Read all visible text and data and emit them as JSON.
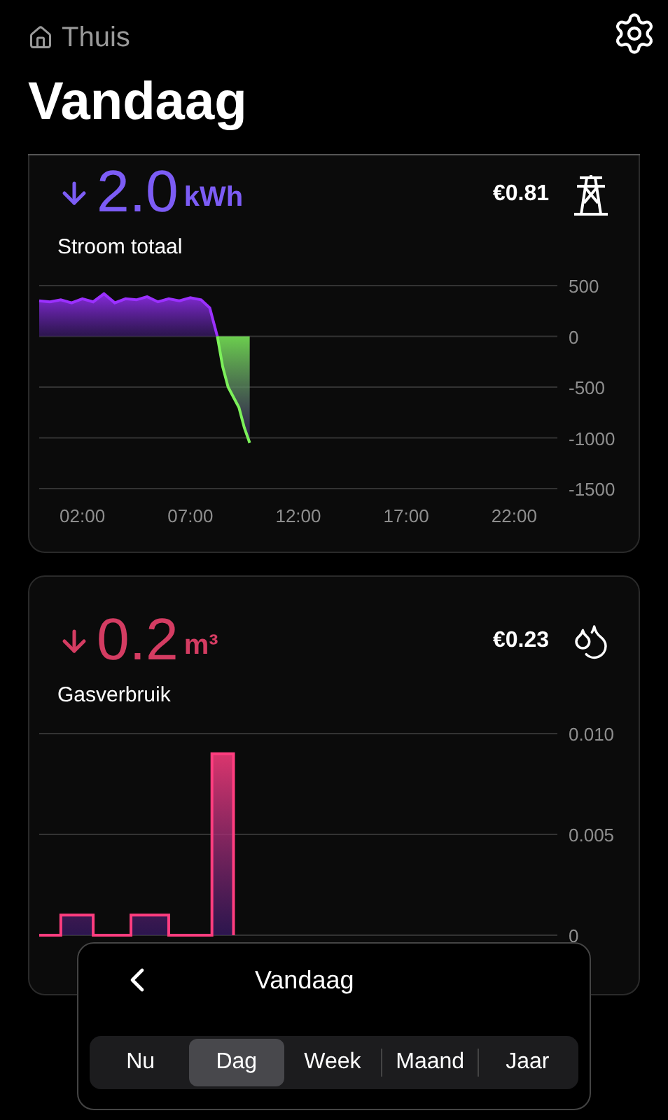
{
  "header": {
    "back_label": "Thuis",
    "title": "Vandaag"
  },
  "cards": [
    {
      "kind": "electricity",
      "value": "2.0",
      "unit": "kWh",
      "label": "Stroom totaal",
      "cost": "€0.81",
      "chart_data": {
        "type": "area",
        "grid": true,
        "x": [
          0,
          0.5,
          1,
          1.5,
          2,
          2.5,
          3,
          3.5,
          4,
          4.5,
          5,
          5.5,
          6,
          6.5,
          7,
          7.5,
          7.9,
          8.25,
          8.5,
          8.75,
          9,
          9.25,
          9.5,
          9.75
        ],
        "xlim": [
          0,
          24
        ],
        "xticks": [
          {
            "value": 2,
            "label": "02:00"
          },
          {
            "value": 7,
            "label": "07:00"
          },
          {
            "value": 12,
            "label": "12:00"
          },
          {
            "value": 17,
            "label": "17:00"
          },
          {
            "value": 22,
            "label": "22:00"
          }
        ],
        "ylim": [
          -1500,
          500
        ],
        "yticks": [
          500,
          0,
          -500,
          -1000,
          -1500
        ],
        "series": [
          {
            "color": "#9b30ff",
            "values": [
              350,
              340,
              360,
              330,
              370,
              340,
              420,
              330,
              370,
              360,
              390,
              340,
              370,
              350,
              380,
              360,
              280,
              0,
              null,
              null,
              null,
              null,
              null,
              null
            ]
          },
          {
            "color": "#7cf05a",
            "values": [
              null,
              null,
              null,
              null,
              null,
              null,
              null,
              null,
              null,
              null,
              null,
              null,
              null,
              null,
              null,
              null,
              null,
              0,
              -300,
              -500,
              -600,
              -700,
              -900,
              -1050
            ]
          }
        ]
      }
    },
    {
      "kind": "gas",
      "value": "0.2",
      "unit": "m³",
      "label": "Gasverbruik",
      "cost": "€0.23",
      "chart_data": {
        "type": "area",
        "grid": true,
        "x": [
          0,
          1,
          1.25,
          1.5,
          1.75,
          2,
          2.25,
          2.5,
          3,
          4,
          4.25,
          4.5,
          5,
          5.5,
          6,
          7,
          7.9,
          8,
          8.5,
          9
        ],
        "xlim": [
          0,
          24
        ],
        "ylim": [
          0,
          0.01
        ],
        "yticks": [
          0,
          0.005,
          {
            "value": 0.01,
            "label": "0.010"
          }
        ],
        "series": [
          {
            "color": "#ff3d7f",
            "values": [
              0,
              0.001,
              0.001,
              0.001,
              0.001,
              0.001,
              0.001,
              0,
              0,
              0,
              0.001,
              0.001,
              0.001,
              0.001,
              0,
              0,
              0,
              0.009,
              0.009,
              0
            ]
          }
        ]
      }
    }
  ],
  "period_picker": {
    "title": "Vandaag",
    "options": [
      {
        "label": "Nu",
        "selected": false
      },
      {
        "label": "Dag",
        "selected": true
      },
      {
        "label": "Week",
        "selected": false
      },
      {
        "label": "Maand",
        "selected": false
      },
      {
        "label": "Jaar",
        "selected": false
      }
    ]
  }
}
